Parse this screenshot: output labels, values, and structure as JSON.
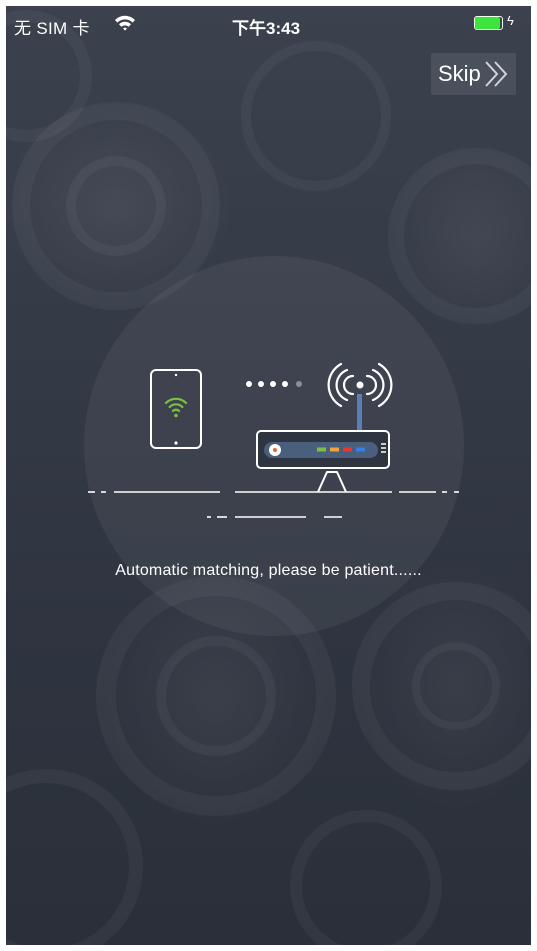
{
  "status_bar": {
    "carrier": "无 SIM 卡",
    "time": "下午3:43",
    "battery_level": 1.0,
    "icons": [
      "wifi-icon",
      "battery-icon",
      "charging-icon"
    ]
  },
  "skip": {
    "label": "Skip",
    "icon": "double-chevron-right-icon"
  },
  "message": "Automatic matching, please be patient......",
  "colors": {
    "background": "#323844",
    "wifi_green": "#7cc13e",
    "battery_green": "#3de43d",
    "router_accents": [
      "#7cc13e",
      "#f2a33a",
      "#e23a2e",
      "#3a7ee2"
    ]
  }
}
